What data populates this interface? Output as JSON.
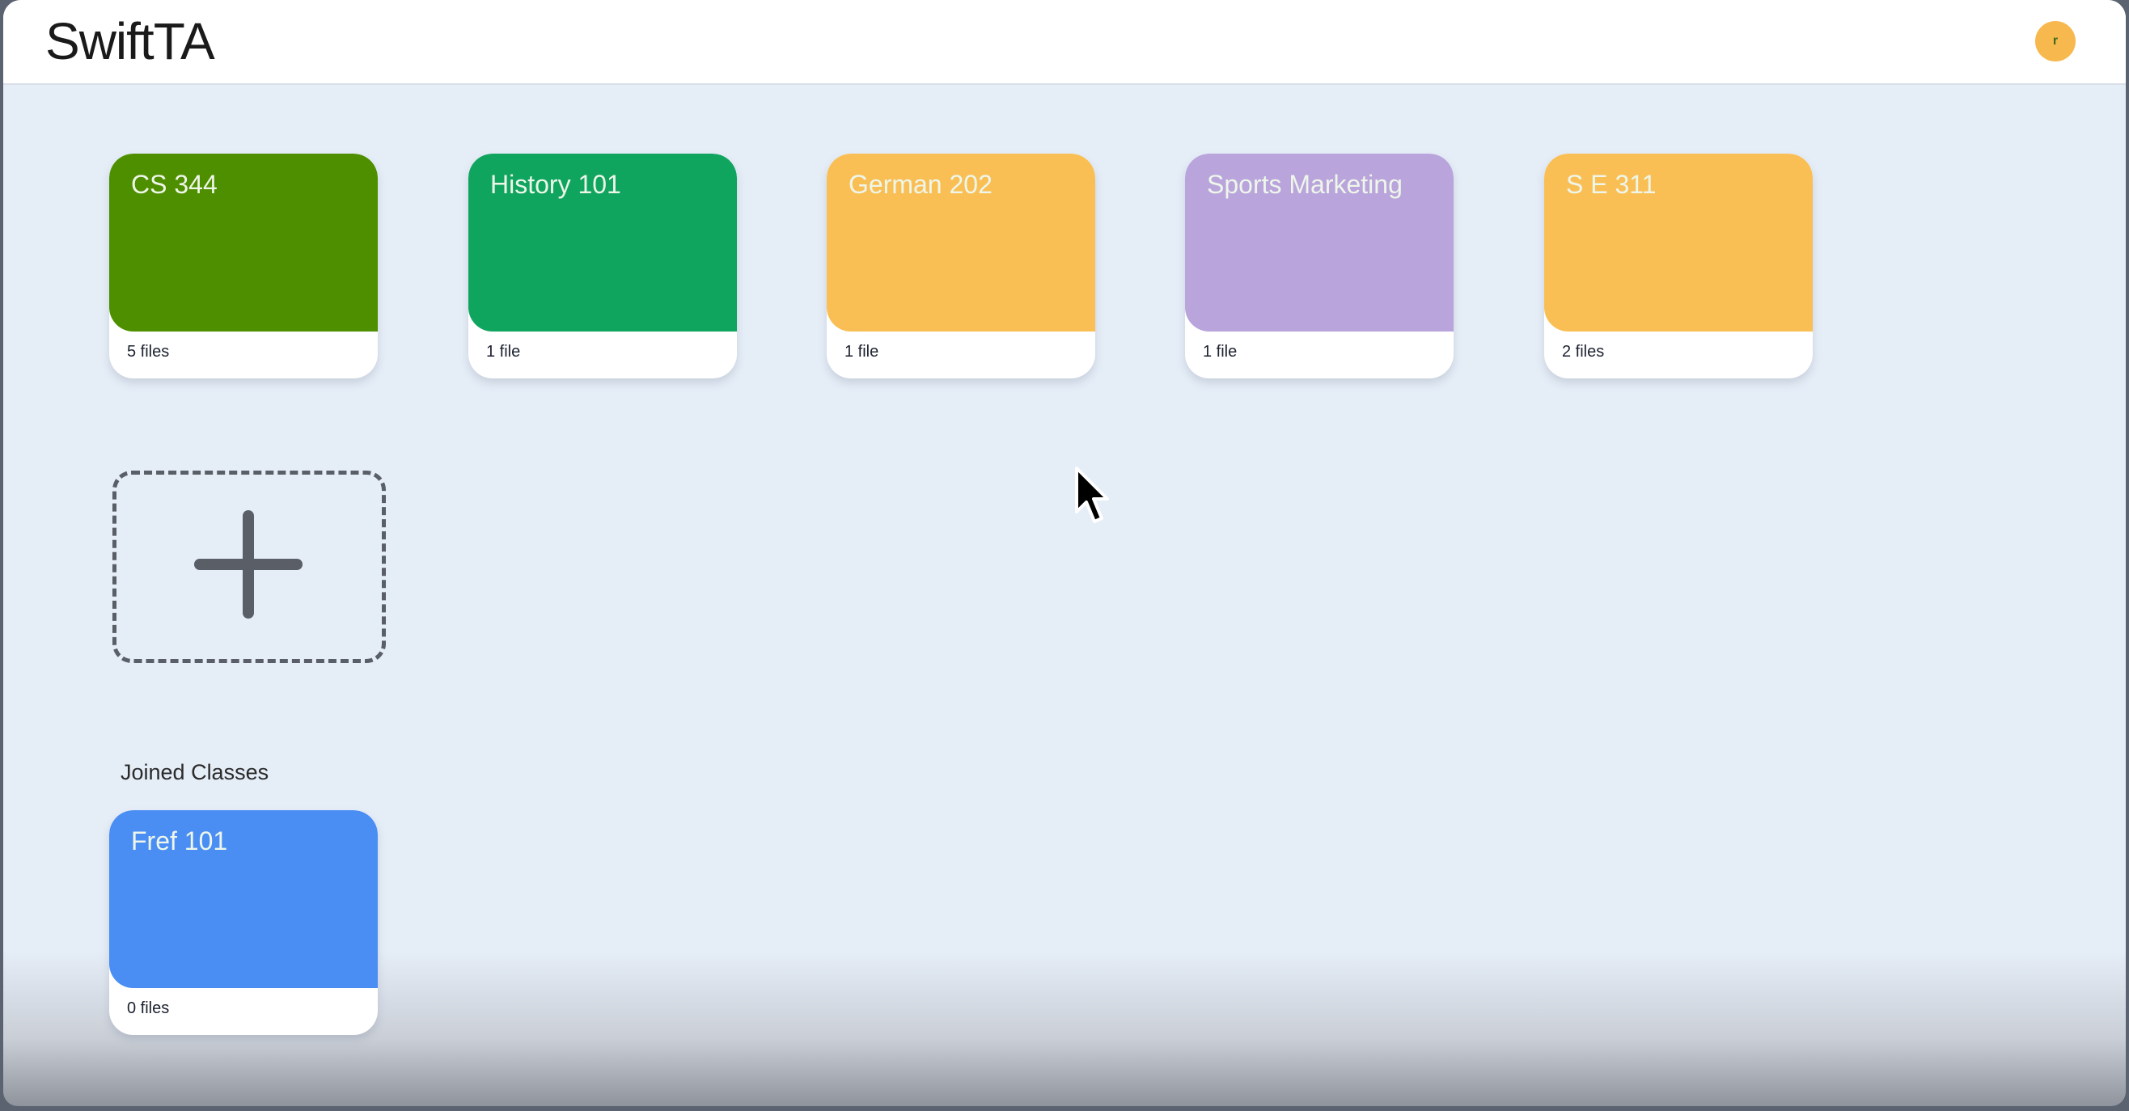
{
  "app": {
    "title": "SwiftTA",
    "avatar_initial": "r",
    "avatar_color": "#f7b84e"
  },
  "classes": [
    {
      "name": "CS 344",
      "files": "5 files",
      "color": "#4e8f00"
    },
    {
      "name": "History 101",
      "files": "1 file",
      "color": "#10a55f"
    },
    {
      "name": "German 202",
      "files": "1 file",
      "color": "#f9bf55"
    },
    {
      "name": "Sports Marketing",
      "files": "1 file",
      "color": "#b9a4dc"
    },
    {
      "name": "S E 311",
      "files": "2 files",
      "color": "#f9bf55"
    }
  ],
  "add_class": {
    "icon": "plus-icon"
  },
  "joined": {
    "label": "Joined Classes",
    "classes": [
      {
        "name": "Fref 101",
        "files": "0 files",
        "color": "#4a8ef4"
      }
    ]
  }
}
